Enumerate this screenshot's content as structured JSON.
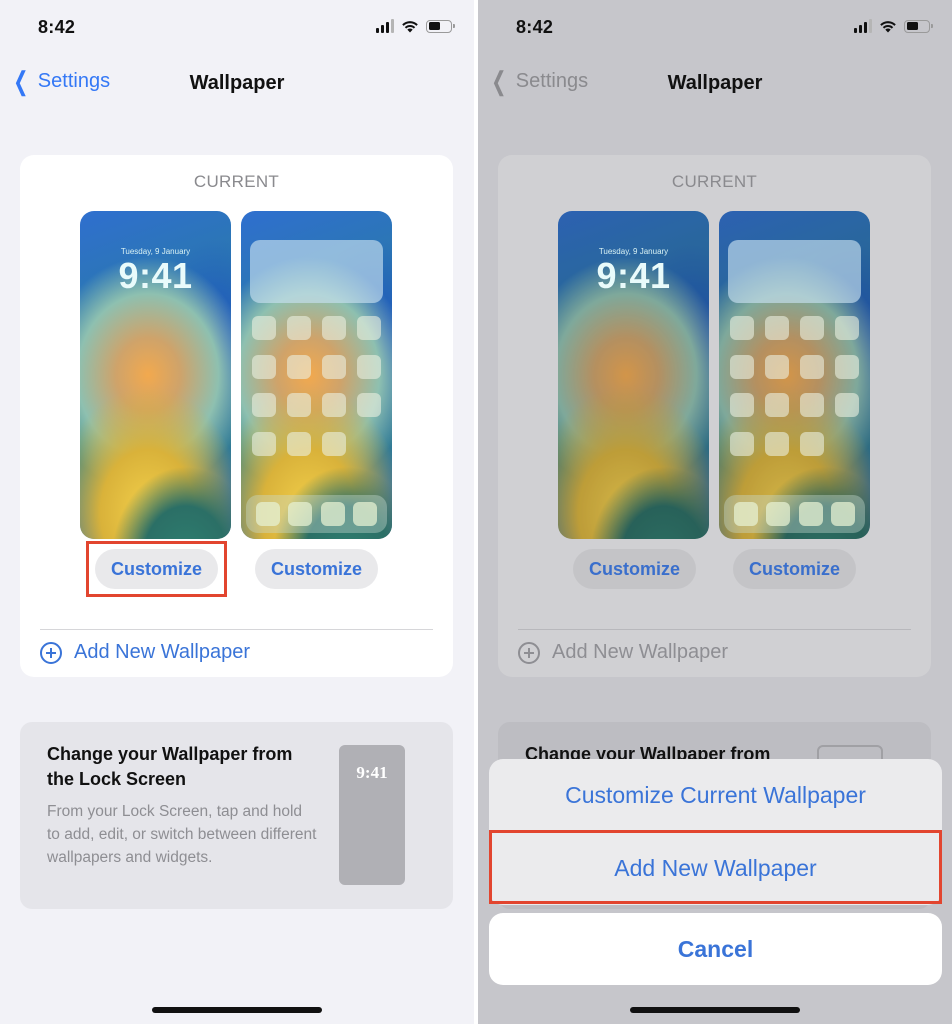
{
  "colors": {
    "accent": "#3a74d8",
    "highlight": "#e2452f",
    "background": "#f2f2f7",
    "dimmed_background": "#c6c6cb"
  },
  "screens": [
    {
      "status_bar": {
        "time": "8:42",
        "icons": [
          "cellular-signal-icon",
          "wifi-icon",
          "battery-icon"
        ]
      },
      "nav": {
        "back_label": "Settings",
        "back_icon": "chevron-left-icon",
        "title": "Wallpaper"
      },
      "current": {
        "section_label": "CURRENT",
        "lock_preview": {
          "date": "Tuesday, 9 January",
          "time": "9:41"
        },
        "customize_buttons": [
          "Customize",
          "Customize"
        ],
        "add_new_label": "Add New Wallpaper",
        "add_new_icon": "plus-circle-icon"
      },
      "info_card": {
        "title": "Change your Wallpaper from the Lock Screen",
        "body": "From your Lock Screen, tap and hold to add, edit, or switch between different wallpapers and widgets.",
        "preview_time": "9:41"
      },
      "highlighted": "Customize"
    },
    {
      "status_bar": {
        "time": "8:42",
        "icons": [
          "cellular-signal-icon",
          "wifi-icon",
          "battery-icon"
        ]
      },
      "nav": {
        "back_label": "Settings",
        "back_icon": "chevron-left-icon",
        "title": "Wallpaper"
      },
      "current": {
        "section_label": "CURRENT",
        "lock_preview": {
          "date": "Tuesday, 9 January",
          "time": "9:41"
        },
        "customize_buttons": [
          "Customize",
          "Customize"
        ],
        "add_new_label": "Add New Wallpaper",
        "add_new_icon": "plus-circle-icon"
      },
      "info_card": {
        "title_partial": "Change your Wallpaper from"
      },
      "action_sheet": {
        "items": [
          "Customize Current Wallpaper",
          "Add New Wallpaper"
        ],
        "cancel_label": "Cancel"
      },
      "highlighted": "Add New Wallpaper"
    }
  ]
}
